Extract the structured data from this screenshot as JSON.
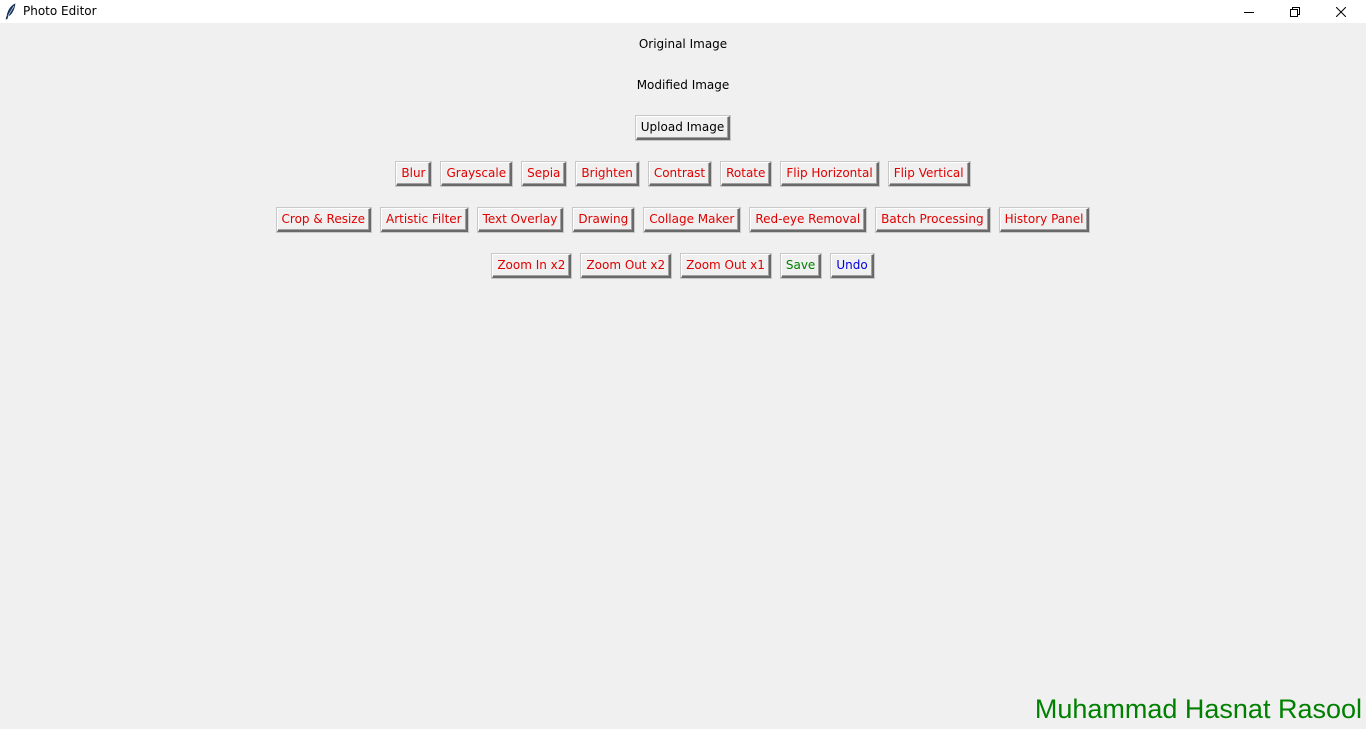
{
  "window": {
    "title": "Photo Editor",
    "icon": "feather-icon",
    "controls": [
      "minimize-icon",
      "maximize-icon",
      "close-icon"
    ]
  },
  "labels": {
    "original": "Original Image",
    "modified": "Modified Image"
  },
  "upload_button": "Upload Image",
  "row1": [
    "Blur",
    "Grayscale",
    "Sepia",
    "Brighten",
    "Contrast",
    "Rotate",
    "Flip Horizontal",
    "Flip Vertical"
  ],
  "row2": [
    "Crop & Resize",
    "Artistic Filter",
    "Text Overlay",
    "Drawing",
    "Collage Maker",
    "Red-eye Removal",
    "Batch Processing",
    "History Panel"
  ],
  "row3": [
    "Zoom In x2",
    "Zoom Out x2",
    "Zoom Out x1",
    "Save",
    "Undo"
  ],
  "author": "Muhammad Hasnat Rasool",
  "colors": {
    "background": "#f0f0f0",
    "filter_text": "#e00000",
    "save_text": "#008000",
    "undo_text": "#0000e0",
    "author_text": "#008000"
  }
}
